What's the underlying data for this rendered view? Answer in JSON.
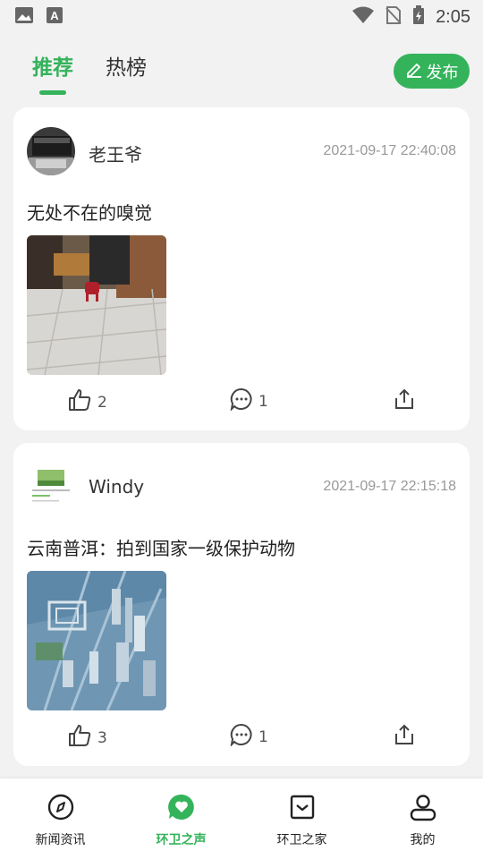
{
  "status_bar": {
    "time": "2:05"
  },
  "tabs": [
    {
      "label": "推荐",
      "active": true
    },
    {
      "label": "热榜",
      "active": false
    }
  ],
  "publish_label": "发布",
  "posts": [
    {
      "username": "老王爷",
      "time": "2021-09-17 22:40:08",
      "text": "无处不在的嗅觉",
      "likes": "2",
      "comments": "1"
    },
    {
      "username": "Windy",
      "time": "2021-09-17 22:15:18",
      "text": "云南普洱：拍到国家一级保护动物",
      "likes": "3",
      "comments": "1"
    }
  ],
  "nav": [
    {
      "label": "新闻资讯",
      "icon": "compass-icon"
    },
    {
      "label": "环卫之声",
      "icon": "heart-chat-icon",
      "active": true
    },
    {
      "label": "环卫之家",
      "icon": "inbox-icon"
    },
    {
      "label": "我的",
      "icon": "user-icon"
    }
  ],
  "colors": {
    "accent": "#34b35b"
  }
}
